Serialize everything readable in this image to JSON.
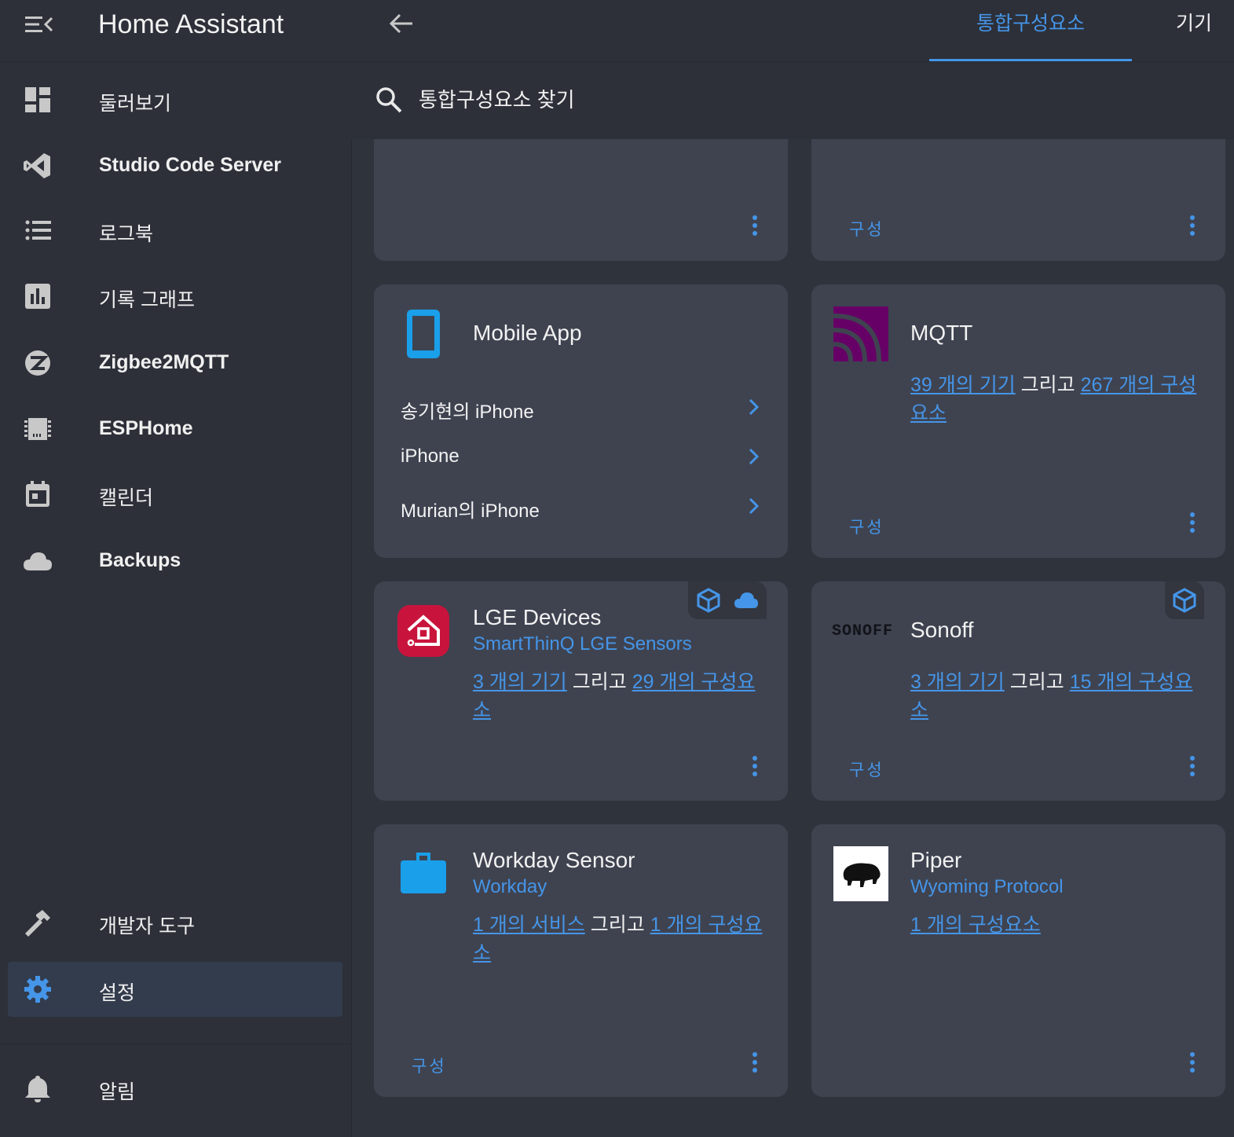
{
  "app": {
    "title": "Home Assistant"
  },
  "sidebar": {
    "items": [
      {
        "label": "둘러보기",
        "icon": "dashboard-icon"
      },
      {
        "label": "Studio Code Server",
        "icon": "vscode-icon"
      },
      {
        "label": "로그북",
        "icon": "logbook-icon"
      },
      {
        "label": "기록 그래프",
        "icon": "history-chart-icon"
      },
      {
        "label": "Zigbee2MQTT",
        "icon": "zigbee-icon"
      },
      {
        "label": "ESPHome",
        "icon": "chip-icon"
      },
      {
        "label": "캘린더",
        "icon": "calendar-icon"
      },
      {
        "label": "Backups",
        "icon": "cloud-icon"
      },
      {
        "label": "개발자 도구",
        "icon": "hammer-icon"
      },
      {
        "label": "설정",
        "icon": "gear-icon",
        "selected": true
      },
      {
        "label": "알림",
        "icon": "bell-icon"
      }
    ]
  },
  "tabs": [
    {
      "label": "통합구성요소",
      "active": true
    },
    {
      "label": "기기",
      "active": false
    }
  ],
  "search": {
    "placeholder": "통합구성요소 찾기"
  },
  "colors": {
    "accent": "#4595e8",
    "card": "#3f4350",
    "sidebar_selected": "#323c4d"
  },
  "cards": {
    "top_right": {
      "configure": "구성"
    },
    "mobile_app": {
      "title": "Mobile App",
      "devices": [
        "송기현의 iPhone",
        "iPhone",
        "Murian의 iPhone"
      ]
    },
    "mqtt": {
      "title": "MQTT",
      "link1": "39 개의 기기",
      "conj": "그리고",
      "link2": "267 개의 구성요소",
      "configure": "구성"
    },
    "lge": {
      "title": "LGE Devices",
      "subtitle": "SmartThinQ LGE Sensors",
      "link1": "3 개의 기기",
      "conj": "그리고",
      "link2": "29 개의 구성요소",
      "badges": [
        "package-icon",
        "cloud-icon"
      ]
    },
    "sonoff": {
      "title": "Sonoff",
      "logo_text": "SONOFF",
      "link1": "3 개의 기기",
      "conj": "그리고",
      "link2": "15 개의 구성요소",
      "configure": "구성",
      "badges": [
        "package-icon"
      ]
    },
    "workday": {
      "title": "Workday Sensor",
      "subtitle": "Workday",
      "link1": "1 개의 서비스",
      "conj": "그리고",
      "link2": "1 개의 구성요소",
      "configure": "구성"
    },
    "piper": {
      "title": "Piper",
      "subtitle": "Wyoming Protocol",
      "link1": "1 개의 구성요소"
    }
  }
}
